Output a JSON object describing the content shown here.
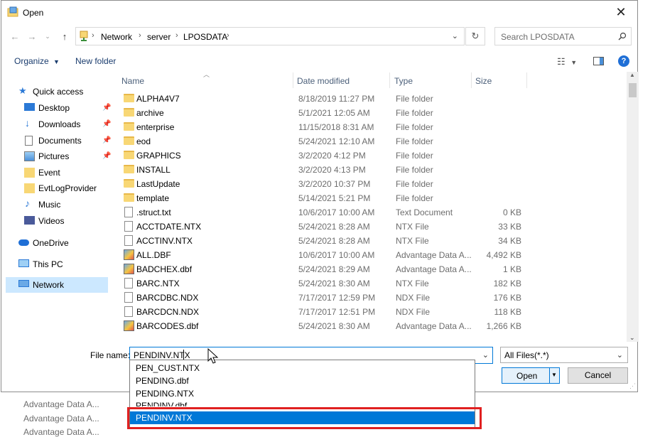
{
  "window": {
    "title": "Open"
  },
  "background_rows": [
    "Advantage Data A...",
    "Advantage Data A...",
    "Advantage Data A..."
  ],
  "breadcrumb": [
    "Network",
    "server",
    "LPOSDATA"
  ],
  "search": {
    "placeholder": "Search LPOSDATA"
  },
  "toolbar": {
    "organize": "Organize",
    "new_folder": "New folder"
  },
  "sidebar": {
    "items": [
      {
        "label": "Quick access",
        "icon": "star-icon"
      },
      {
        "label": "Desktop",
        "icon": "desktop-icon"
      },
      {
        "label": "Downloads",
        "icon": "download-icon"
      },
      {
        "label": "Documents",
        "icon": "documents-icon"
      },
      {
        "label": "Pictures",
        "icon": "pictures-icon"
      },
      {
        "label": "Event",
        "icon": "folder-icon"
      },
      {
        "label": "EvtLogProvider",
        "icon": "folder-icon"
      },
      {
        "label": "Music",
        "icon": "music-icon"
      },
      {
        "label": "Videos",
        "icon": "videos-icon"
      },
      {
        "label": "OneDrive",
        "icon": "cloud-icon"
      },
      {
        "label": "This PC",
        "icon": "computer-icon"
      },
      {
        "label": "Network",
        "icon": "network-icon"
      }
    ]
  },
  "columns": {
    "name": "Name",
    "date": "Date modified",
    "type": "Type",
    "size": "Size"
  },
  "files": [
    {
      "name": "ALPHA4V7",
      "date": "8/18/2019 11:27 PM",
      "type": "File folder",
      "size": "",
      "kind": "folder"
    },
    {
      "name": "archive",
      "date": "5/1/2021 12:05 AM",
      "type": "File folder",
      "size": "",
      "kind": "folder"
    },
    {
      "name": "enterprise",
      "date": "11/15/2018 8:31 AM",
      "type": "File folder",
      "size": "",
      "kind": "folder"
    },
    {
      "name": "eod",
      "date": "5/24/2021 12:10 AM",
      "type": "File folder",
      "size": "",
      "kind": "folder"
    },
    {
      "name": "GRAPHICS",
      "date": "3/2/2020 4:12 PM",
      "type": "File folder",
      "size": "",
      "kind": "folder"
    },
    {
      "name": "INSTALL",
      "date": "3/2/2020 4:13 PM",
      "type": "File folder",
      "size": "",
      "kind": "folder"
    },
    {
      "name": "LastUpdate",
      "date": "3/2/2020 10:37 PM",
      "type": "File folder",
      "size": "",
      "kind": "folder"
    },
    {
      "name": "template",
      "date": "5/14/2021 5:21 PM",
      "type": "File folder",
      "size": "",
      "kind": "folder"
    },
    {
      "name": ".struct.txt",
      "date": "10/6/2017 10:00 AM",
      "type": "Text Document",
      "size": "0 KB",
      "kind": "file"
    },
    {
      "name": "ACCTDATE.NTX",
      "date": "5/24/2021 8:28 AM",
      "type": "NTX File",
      "size": "33 KB",
      "kind": "file"
    },
    {
      "name": "ACCTINV.NTX",
      "date": "5/24/2021 8:28 AM",
      "type": "NTX File",
      "size": "34 KB",
      "kind": "file"
    },
    {
      "name": "ALL.DBF",
      "date": "10/6/2017 10:00 AM",
      "type": "Advantage Data A...",
      "size": "4,492 KB",
      "kind": "dbf"
    },
    {
      "name": "BADCHEX.dbf",
      "date": "5/24/2021 8:29 AM",
      "type": "Advantage Data A...",
      "size": "1 KB",
      "kind": "dbf"
    },
    {
      "name": "BARC.NTX",
      "date": "5/24/2021 8:30 AM",
      "type": "NTX File",
      "size": "182 KB",
      "kind": "file"
    },
    {
      "name": "BARCDBC.NDX",
      "date": "7/17/2017 12:59 PM",
      "type": "NDX File",
      "size": "176 KB",
      "kind": "file"
    },
    {
      "name": "BARCDCN.NDX",
      "date": "7/17/2017 12:51 PM",
      "type": "NDX File",
      "size": "118 KB",
      "kind": "file"
    },
    {
      "name": "BARCODES.dbf",
      "date": "5/24/2021 8:30 AM",
      "type": "Advantage Data A...",
      "size": "1,266 KB",
      "kind": "dbf"
    }
  ],
  "filename": {
    "label": "File name:",
    "value": "PENDINV.NTX"
  },
  "filter": {
    "value": "All Files(*.*)"
  },
  "buttons": {
    "open": "Open",
    "cancel": "Cancel"
  },
  "autocomplete": [
    "PEN_CUST.NTX",
    "PENDING.dbf",
    "PENDING.NTX",
    "PENDINV.dbf",
    "PENDINV.NTX"
  ],
  "autocomplete_selected": "PENDINV.NTX"
}
